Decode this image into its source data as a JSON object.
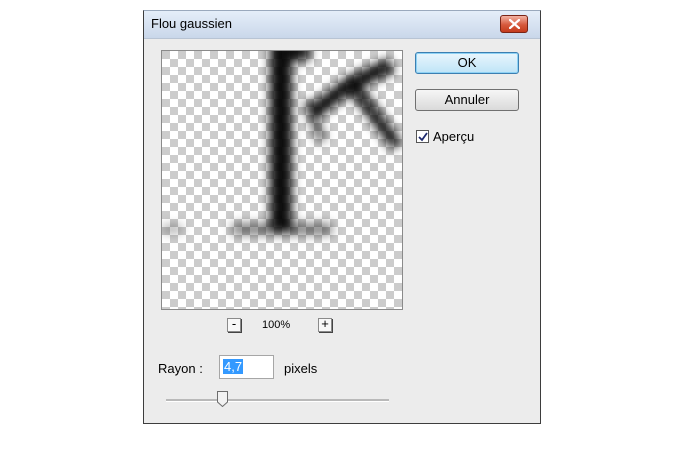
{
  "dialog": {
    "title": "Flou gaussien",
    "close_icon": "close-icon"
  },
  "buttons": {
    "ok_label": "OK",
    "cancel_label": "Annuler"
  },
  "preview_option": {
    "label": "Aperçu",
    "checked": true
  },
  "zoom": {
    "minus_label": "-",
    "plus_label": "+",
    "level": "100%"
  },
  "radius": {
    "label": "Rayon :",
    "value": "4,7",
    "unit": "pixels",
    "slider_fraction": 0.25
  },
  "colors": {
    "ok_accent": "#3c7fb1",
    "close_red": "#d6593c",
    "selection": "#3399ff"
  }
}
